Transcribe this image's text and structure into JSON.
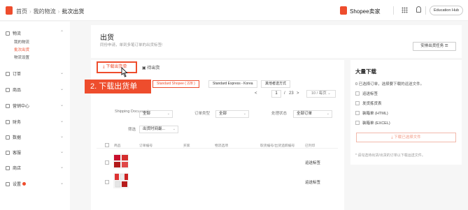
{
  "header": {
    "breadcrumb": [
      "首页",
      "我的物流",
      "批次出货"
    ],
    "shop_name": "Shopee卖家",
    "edu_button": "Education Hub"
  },
  "sidebar": {
    "logistics": {
      "label": "物流",
      "items": [
        "我的物流",
        "批次出货",
        "物流设置"
      ]
    },
    "groups": [
      "订单",
      "商品",
      "营销中心",
      "财务",
      "数据",
      "客服",
      "商店",
      "设置"
    ]
  },
  "main": {
    "title": "出货",
    "subtitle": "同份申请，单到多笔订单的出货标签!",
    "task_button": "安排出货任务 ☰",
    "tabs": {
      "download": "下载出货单",
      "pending": "待出货"
    },
    "callout": "2. 下载出货单",
    "channels": [
      "Standard Shopee ( 228 )",
      "Standard Express - Korea",
      "其他者送方式"
    ],
    "pager": {
      "prev": "<",
      "current": "1",
      "separator": "/",
      "total": "23",
      "next": ">",
      "per_page": "10 / 每页"
    },
    "filters": {
      "shipping_doc_label": "Shipping Document",
      "shipping_doc_value": "全部",
      "order_type_label": "订单类型",
      "order_type_value": "全部",
      "process_status_label": "处理状态",
      "process_status_value": "全部订单",
      "filter_label": "筛选",
      "filter_value": "出货时间最..."
    },
    "table_headers": [
      "商品",
      "订单编号",
      "买家",
      "物流选项",
      "取货编号/出货追踪编号",
      "已列印"
    ],
    "rows": [
      {
        "action": "运送标签"
      },
      {
        "action": "运送标签"
      }
    ]
  },
  "bulk": {
    "title": "大量下载",
    "subtitle": "0 已选择订单，选择要下载的运送文件。",
    "options": [
      "运送标签",
      "发货拣货表",
      "装箱单 (HTML)",
      "装箱单 (EXCEL)"
    ],
    "download_button": "下载已选择文件",
    "note": "* 请勾选待出货/出货的订单以下载运送文件。"
  },
  "colors": {
    "brand": "#ee4d2d"
  }
}
